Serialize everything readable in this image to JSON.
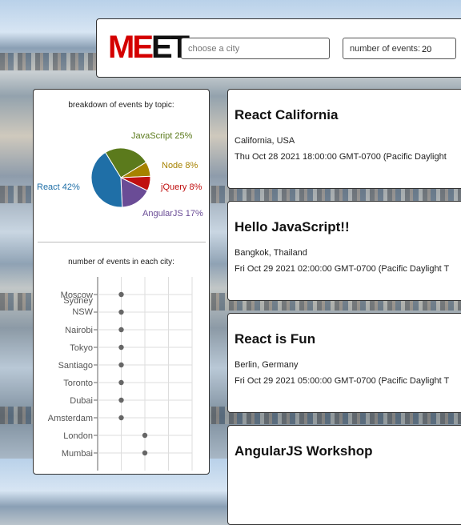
{
  "header": {
    "logo_left": "ME",
    "logo_right": "ET",
    "city_placeholder": "choose a city",
    "num_events_label": "number of events:",
    "num_events_value": "20"
  },
  "sidebar": {
    "topic_chart_title": "breakdown of events by topic:",
    "city_chart_title": "number of events in each city:"
  },
  "chart_data": [
    {
      "type": "pie",
      "title": "breakdown of events by topic:",
      "slices": [
        {
          "label": "React 42%",
          "topic": "React",
          "value": 42,
          "color": "#1f6fa7"
        },
        {
          "label": "JavaScript 25%",
          "topic": "JavaScript",
          "value": 25,
          "color": "#5b7a1c"
        },
        {
          "label": "Node 8%",
          "topic": "Node",
          "value": 8,
          "color": "#a68200"
        },
        {
          "label": "jQuery 8%",
          "topic": "jQuery",
          "value": 8,
          "color": "#c00f0f"
        },
        {
          "label": "AngularJS 17%",
          "topic": "AngularJS",
          "value": 17,
          "color": "#6a4c96"
        }
      ]
    },
    {
      "type": "scatter",
      "title": "number of events in each city:",
      "categories": [
        "Moscow",
        "Sydney NSW",
        "Nairobi",
        "Tokyo",
        "Santiago",
        "Toronto",
        "Dubai",
        "Amsterdam",
        "London",
        "Mumbai"
      ],
      "values": [
        1,
        1,
        1,
        1,
        1,
        1,
        1,
        1,
        2,
        2
      ],
      "xlim": [
        0,
        4
      ],
      "grid": true
    }
  ],
  "events": [
    {
      "title": "React California",
      "location": "California, USA",
      "date": "Thu Oct 28 2021 18:00:00 GMT-0700 (Pacific Daylight"
    },
    {
      "title": "Hello JavaScript!!",
      "location": "Bangkok, Thailand",
      "date": "Fri Oct 29 2021 02:00:00 GMT-0700 (Pacific Daylight T"
    },
    {
      "title": "React is Fun",
      "location": "Berlin, Germany",
      "date": "Fri Oct 29 2021 05:00:00 GMT-0700 (Pacific Daylight T"
    },
    {
      "title": "AngularJS Workshop",
      "location": "",
      "date": ""
    }
  ]
}
